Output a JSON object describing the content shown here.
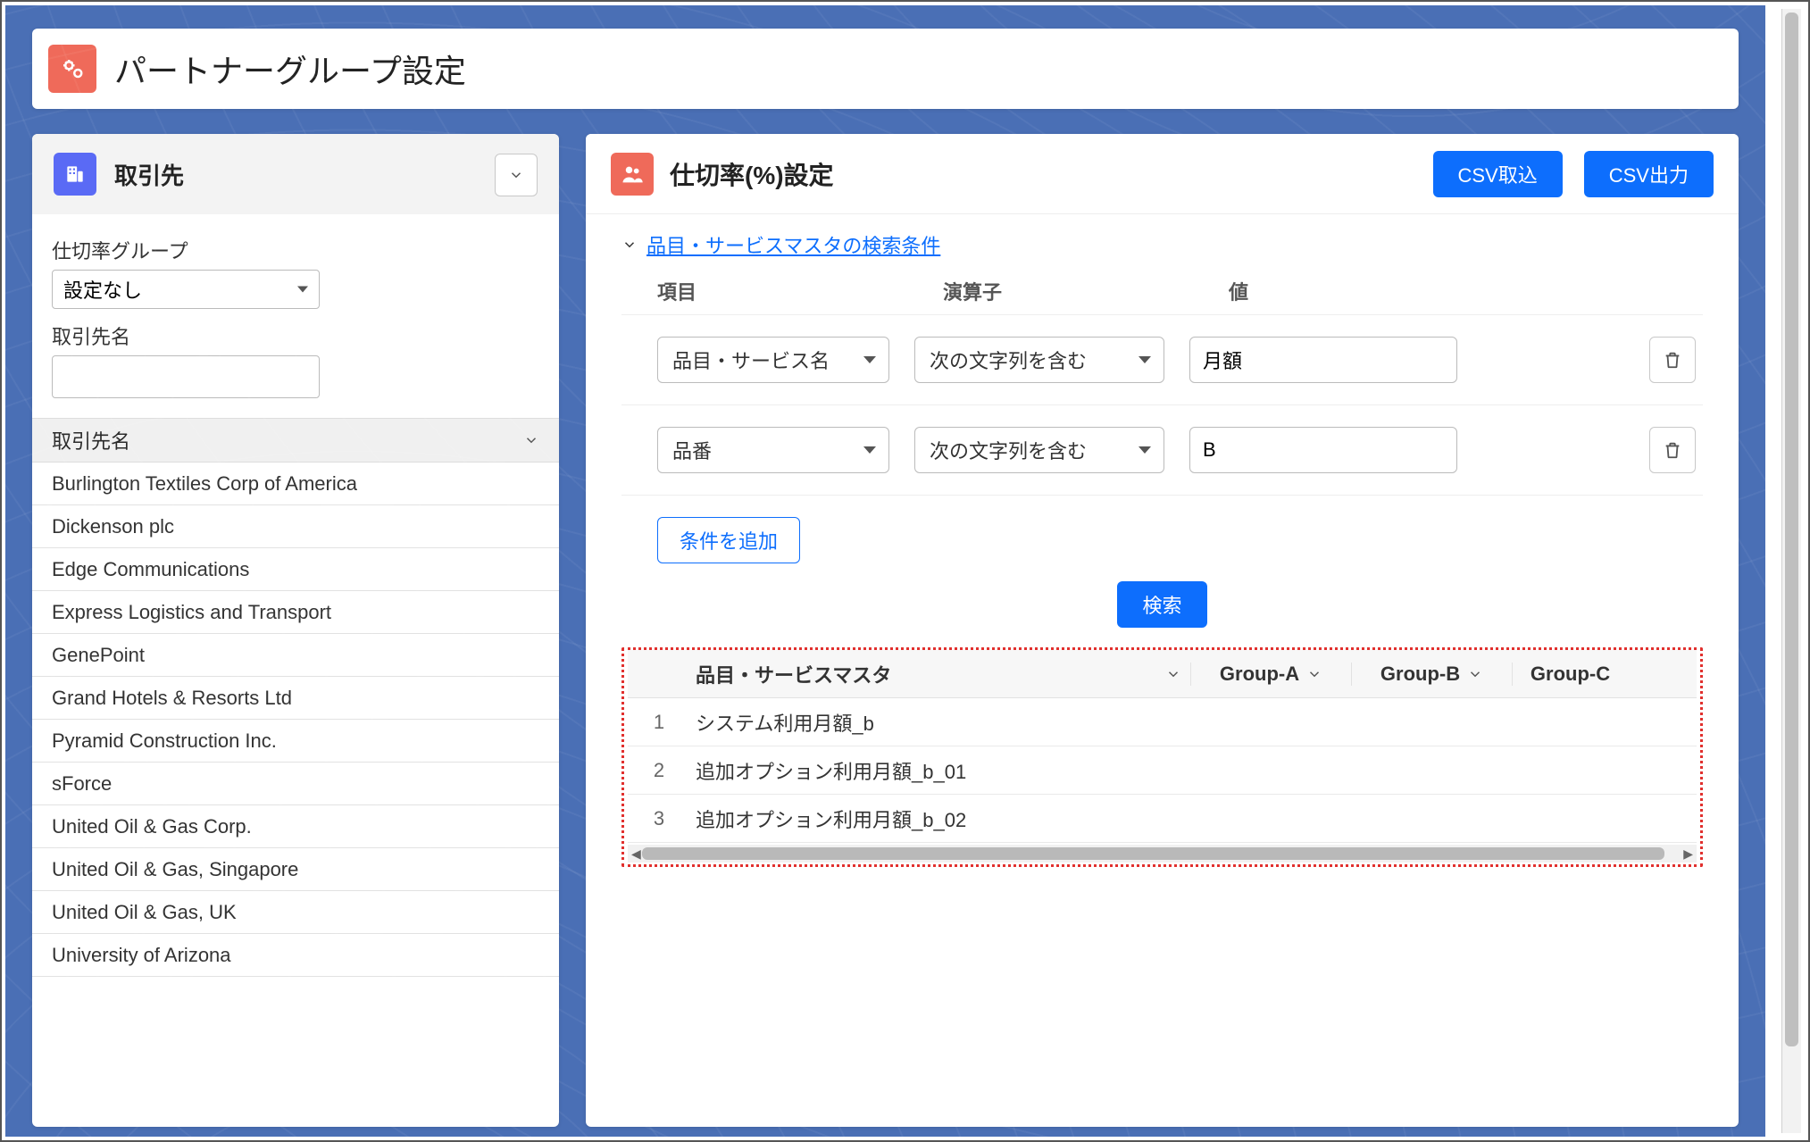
{
  "page": {
    "title": "パートナーグループ設定"
  },
  "left": {
    "title": "取引先",
    "filters": {
      "groupLabel": "仕切率グループ",
      "groupValue": "設定なし",
      "nameLabel": "取引先名",
      "nameValue": ""
    },
    "listHeader": "取引先名",
    "accounts": [
      "Burlington Textiles Corp of America",
      "Dickenson plc",
      "Edge Communications",
      "Express Logistics and Transport",
      "GenePoint",
      "Grand Hotels & Resorts Ltd",
      "Pyramid Construction Inc.",
      "sForce",
      "United Oil & Gas Corp.",
      "United Oil & Gas, Singapore",
      "United Oil & Gas, UK",
      "University of Arizona"
    ]
  },
  "right": {
    "title": "仕切率(%)設定",
    "csvImport": "CSV取込",
    "csvExport": "CSV出力",
    "searchExpandLabel": "品目・サービスマスタの検索条件",
    "condHeader": {
      "item": "項目",
      "op": "演算子",
      "val": "値"
    },
    "conditions": [
      {
        "item": "品目・サービス名",
        "op": "次の文字列を含む",
        "val": "月額"
      },
      {
        "item": "品番",
        "op": "次の文字列を含む",
        "val": "B"
      }
    ],
    "addCondition": "条件を追加",
    "searchBtn": "検索",
    "results": {
      "masterHeader": "品目・サービスマスタ",
      "groupHeaders": [
        "Group-A",
        "Group-B",
        "Group-C"
      ],
      "rows": [
        "システム利用月額_b",
        "追加オプション利用月額_b_01",
        "追加オプション利用月額_b_02"
      ]
    }
  }
}
